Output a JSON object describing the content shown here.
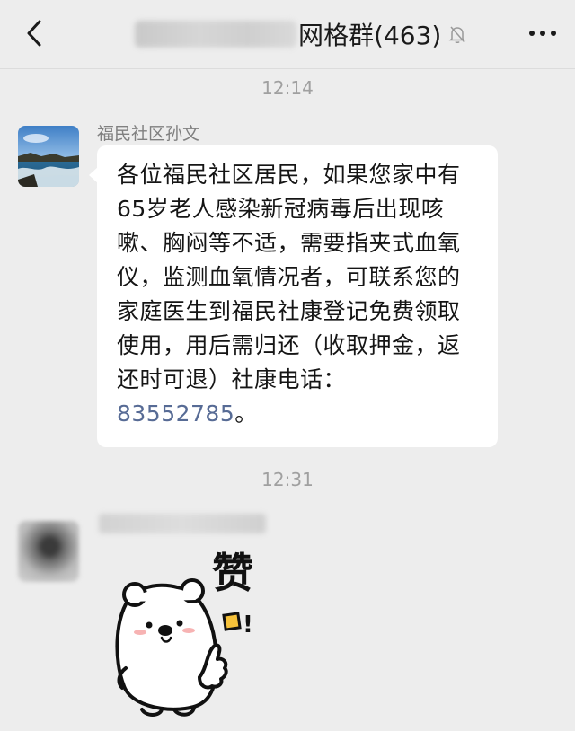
{
  "header": {
    "title_suffix": "网格群",
    "member_count": "(463)",
    "back_icon": "chevron-left-icon",
    "mute_icon": "bell-muted-icon",
    "more_icon": "more-dots-icon"
  },
  "messages": [
    {
      "time": "12:14",
      "sender": "福民社区孙文",
      "text": "各位福民社区居民，如果您家中有65岁老人感染新冠病毒后出现咳嗽、胸闷等不适，需要指夹式血氧仪，监测血氧情况者，可联系您的家庭医生到福民社康登记免费领取使用，用后需归还（收取押金，返还时可退）社康电话：",
      "phone": "83552785",
      "text_end": "。"
    },
    {
      "time": "12:31",
      "sticker_text": "赞",
      "sticker_mark": "!"
    }
  ],
  "colors": {
    "background": "#ededed",
    "bubble": "#ffffff",
    "link": "#576b95",
    "meta_text": "#a0a0a0"
  }
}
